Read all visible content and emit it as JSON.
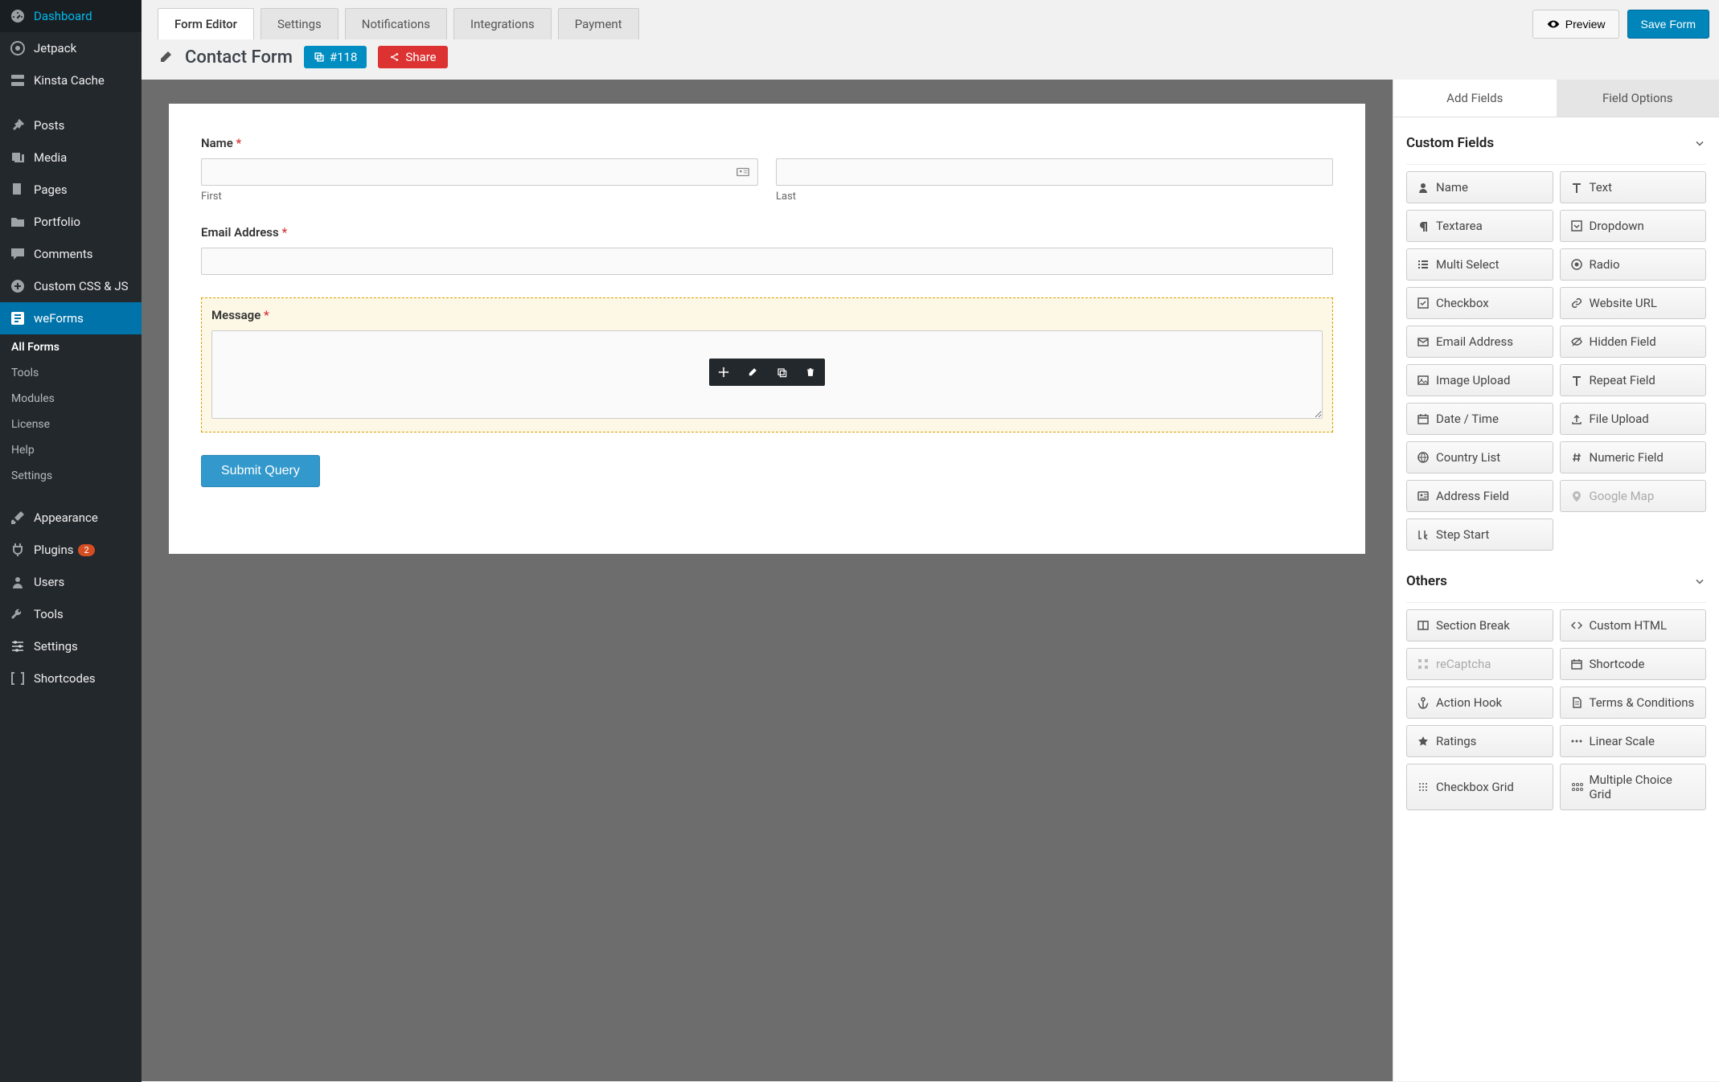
{
  "sidebar": {
    "items": [
      {
        "label": "Dashboard",
        "icon": "gauge"
      },
      {
        "label": "Jetpack",
        "icon": "circle-dot"
      },
      {
        "label": "Kinsta Cache",
        "icon": "server"
      }
    ],
    "items2": [
      {
        "label": "Posts",
        "icon": "pin"
      },
      {
        "label": "Media",
        "icon": "media"
      },
      {
        "label": "Pages",
        "icon": "page"
      },
      {
        "label": "Portfolio",
        "icon": "folder"
      },
      {
        "label": "Comments",
        "icon": "comment"
      },
      {
        "label": "Custom CSS & JS",
        "icon": "plus-circle"
      },
      {
        "label": "weForms",
        "icon": "weforms",
        "active": true
      }
    ],
    "sub": [
      {
        "label": "All Forms",
        "active": true
      },
      {
        "label": "Tools"
      },
      {
        "label": "Modules"
      },
      {
        "label": "License"
      },
      {
        "label": "Help"
      },
      {
        "label": "Settings"
      }
    ],
    "items3": [
      {
        "label": "Appearance",
        "icon": "brush"
      },
      {
        "label": "Plugins",
        "icon": "plug",
        "badge": "2"
      },
      {
        "label": "Users",
        "icon": "user"
      },
      {
        "label": "Tools",
        "icon": "wrench"
      },
      {
        "label": "Settings",
        "icon": "sliders"
      },
      {
        "label": "Shortcodes",
        "icon": "brackets"
      }
    ]
  },
  "topbar": {
    "tabs": [
      "Form Editor",
      "Settings",
      "Notifications",
      "Integrations",
      "Payment"
    ],
    "preview": "Preview",
    "save": "Save Form"
  },
  "titlebar": {
    "title": "Contact Form",
    "id": "#118",
    "share": "Share"
  },
  "form": {
    "name_label": "Name",
    "first_label": "First",
    "last_label": "Last",
    "email_label": "Email Address",
    "message_label": "Message",
    "submit": "Submit Query"
  },
  "panel": {
    "tabs": [
      "Add Fields",
      "Field Options"
    ],
    "sections": {
      "custom": {
        "title": "Custom Fields",
        "fields": [
          {
            "label": "Name",
            "icon": "user"
          },
          {
            "label": "Text",
            "icon": "text"
          },
          {
            "label": "Textarea",
            "icon": "para"
          },
          {
            "label": "Dropdown",
            "icon": "caret-sq"
          },
          {
            "label": "Multi Select",
            "icon": "list"
          },
          {
            "label": "Radio",
            "icon": "radio"
          },
          {
            "label": "Checkbox",
            "icon": "check-sq"
          },
          {
            "label": "Website URL",
            "icon": "link"
          },
          {
            "label": "Email Address",
            "icon": "mail"
          },
          {
            "label": "Hidden Field",
            "icon": "eye-off"
          },
          {
            "label": "Image Upload",
            "icon": "image"
          },
          {
            "label": "Repeat Field",
            "icon": "text"
          },
          {
            "label": "Date / Time",
            "icon": "calendar"
          },
          {
            "label": "File Upload",
            "icon": "upload"
          },
          {
            "label": "Country List",
            "icon": "globe"
          },
          {
            "label": "Numeric Field",
            "icon": "hash"
          },
          {
            "label": "Address Field",
            "icon": "address"
          },
          {
            "label": "Google Map",
            "icon": "marker",
            "disabled": true
          },
          {
            "label": "Step Start",
            "icon": "step"
          }
        ]
      },
      "others": {
        "title": "Others",
        "fields": [
          {
            "label": "Section Break",
            "icon": "columns"
          },
          {
            "label": "Custom HTML",
            "icon": "code"
          },
          {
            "label": "reCaptcha",
            "icon": "grid",
            "disabled": true
          },
          {
            "label": "Shortcode",
            "icon": "calendar"
          },
          {
            "label": "Action Hook",
            "icon": "anchor"
          },
          {
            "label": "Terms & Conditions",
            "icon": "file"
          },
          {
            "label": "Ratings",
            "icon": "star"
          },
          {
            "label": "Linear Scale",
            "icon": "dots"
          },
          {
            "label": "Checkbox Grid",
            "icon": "grid4"
          },
          {
            "label": "Multiple Choice Grid",
            "icon": "radio-grid"
          }
        ]
      }
    }
  }
}
